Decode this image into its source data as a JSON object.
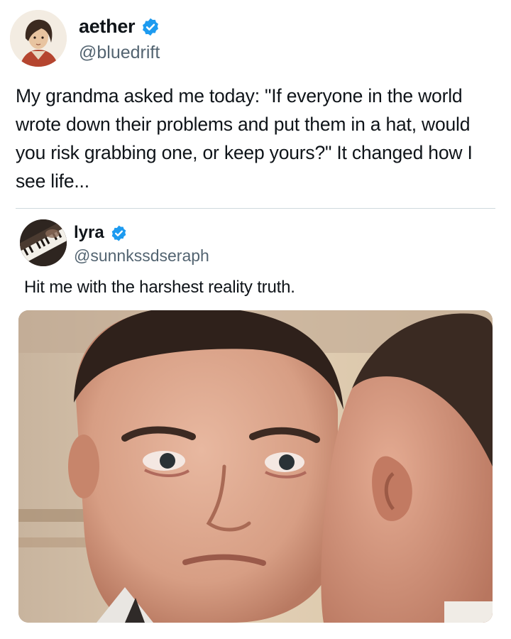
{
  "post": {
    "author_name": "aether",
    "author_handle": "@bluedrift",
    "verified": true,
    "text": "My grandma asked me today: \"If everyone in the world wrote down their problems and put them in a hat, would you risk grabbing one, or keep yours?\" It changed how I see life..."
  },
  "quoted_post": {
    "author_name": "lyra",
    "author_handle": "@sunnkssdseraph",
    "verified": true,
    "text": "Hit me with the harshest reality truth."
  },
  "colors": {
    "verified_badge": "#1d9bf0",
    "secondary_text": "#536471",
    "divider": "#cfd9de"
  },
  "icons": {
    "verified": "verified-badge-icon"
  }
}
